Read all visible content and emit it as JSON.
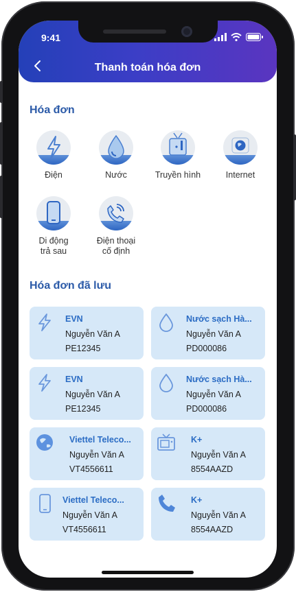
{
  "status_bar": {
    "time": "9:41"
  },
  "header": {
    "title": "Thanh toán hóa đơn"
  },
  "bills_section": {
    "title": "Hóa đơn",
    "categories": [
      {
        "label": "Điện",
        "icon": "lightning-icon"
      },
      {
        "label": "Nước",
        "icon": "water-drop-icon"
      },
      {
        "label": "Truyền hình",
        "icon": "tv-icon"
      },
      {
        "label": "Internet",
        "icon": "globe-icon"
      },
      {
        "label": "Di động\ntrả sau",
        "icon": "mobile-phone-icon"
      },
      {
        "label": "Điện thoại\ncố định",
        "icon": "landline-phone-icon"
      }
    ]
  },
  "saved_section": {
    "title": "Hóa đơn đã lưu",
    "cards": [
      {
        "name": "EVN",
        "owner": "Nguyễn Văn A",
        "code": "PE12345",
        "icon": "lightning-icon"
      },
      {
        "name": "Nước sạch Hà...",
        "owner": "Nguyễn Văn A",
        "code": "PD000086",
        "icon": "water-drop-icon"
      },
      {
        "name": "EVN",
        "owner": "Nguyễn Văn A",
        "code": "PE12345",
        "icon": "lightning-icon"
      },
      {
        "name": "Nước sạch Hà...",
        "owner": "Nguyễn Văn A",
        "code": "PD000086",
        "icon": "water-drop-icon"
      },
      {
        "name": "Viettel Teleco...",
        "owner": "Nguyễn Văn A",
        "code": "VT4556611",
        "icon": "globe-icon"
      },
      {
        "name": "K+",
        "owner": "Nguyễn Văn A",
        "code": "8554AAZD",
        "icon": "tv-icon"
      },
      {
        "name": "Viettel Teleco...",
        "owner": "Nguyễn Văn A",
        "code": "VT4556611",
        "icon": "mobile-phone-icon"
      },
      {
        "name": "K+",
        "owner": "Nguyễn Văn A",
        "code": "8554AAZD",
        "icon": "landline-phone-icon"
      }
    ]
  },
  "colors": {
    "accent": "#2b5aa8",
    "card_bg": "#d6e8f8",
    "header_start": "#2440b8",
    "header_end": "#5a35c0"
  }
}
